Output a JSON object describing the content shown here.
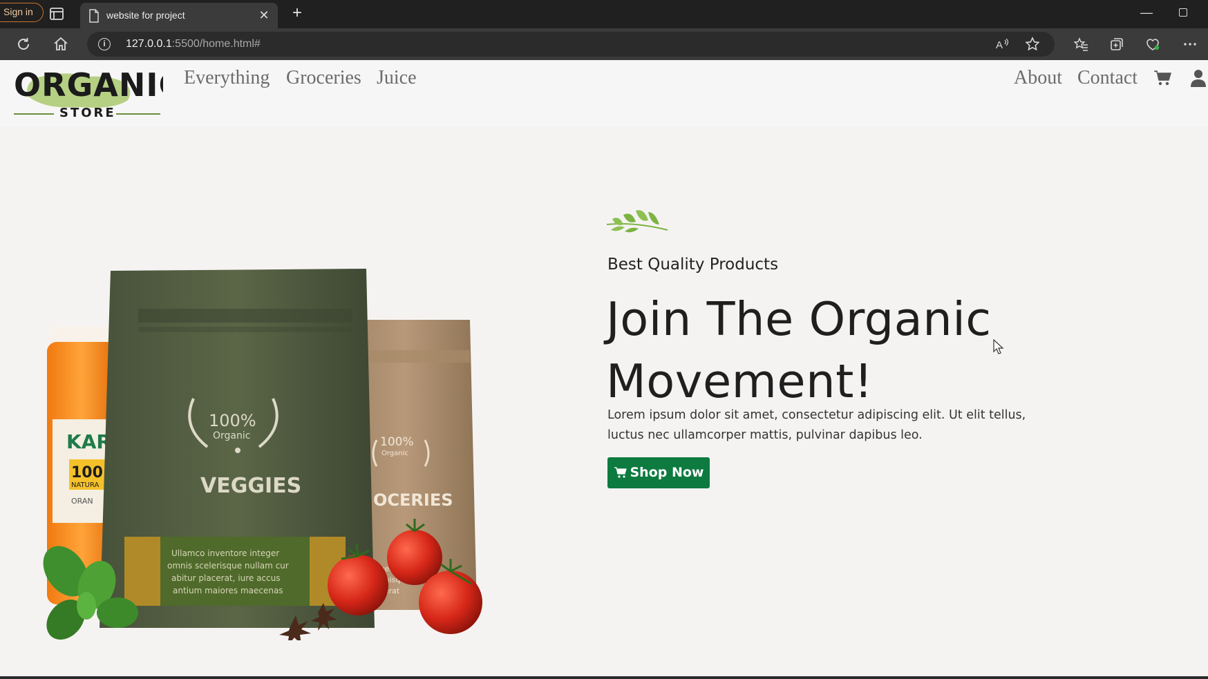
{
  "browser": {
    "signin_label": "Sign in",
    "tab_title": "website for project",
    "url_host": "127.0.0.1",
    "url_path": ":5500/home.html#"
  },
  "navbar": {
    "logo_text_main": "ORGANIC",
    "logo_text_sub": "STORE",
    "left_links": [
      "Everything",
      "Groceries",
      "Juice"
    ],
    "right_links": [
      "About",
      "Contact"
    ]
  },
  "hero": {
    "eyebrow": "Best Quality Products",
    "headline_line1": "Join The Organic",
    "headline_line2": "Movement!",
    "lede": "Lorem ipsum dolor sit amet, consectetur adipiscing elit. Ut elit tellus, luctus nec ullamcorper mattis, pulvinar dapibus leo.",
    "cta_label": "Shop Now",
    "image": {
      "bag1_badge_pct": "100%",
      "bag1_badge_word": "Organic",
      "bag1_label": "VEGGIES",
      "bag1_text_1": "Ullamco inventore integer",
      "bag1_text_2": "omnis scelerisque nullam cur",
      "bag1_text_3": "abitur placerat, iure accus",
      "bag1_text_4": "antium maiores maecenas",
      "bag2_badge_pct": "100%",
      "bag2_badge_word": "Organic",
      "bag2_label": "OCERIES",
      "bag2_text_1": "inventore integ",
      "bag2_text_2": "elenisque null",
      "bag2_text_3": "lacerat",
      "jar_brand": "KAR",
      "jar_pct": "100",
      "jar_word": "NATURA",
      "jar_flavor": "ORAN"
    }
  },
  "colors": {
    "accent_green": "#0d7a3f",
    "leaf_green": "#7cb342",
    "page_bg": "#f5f3f2"
  }
}
